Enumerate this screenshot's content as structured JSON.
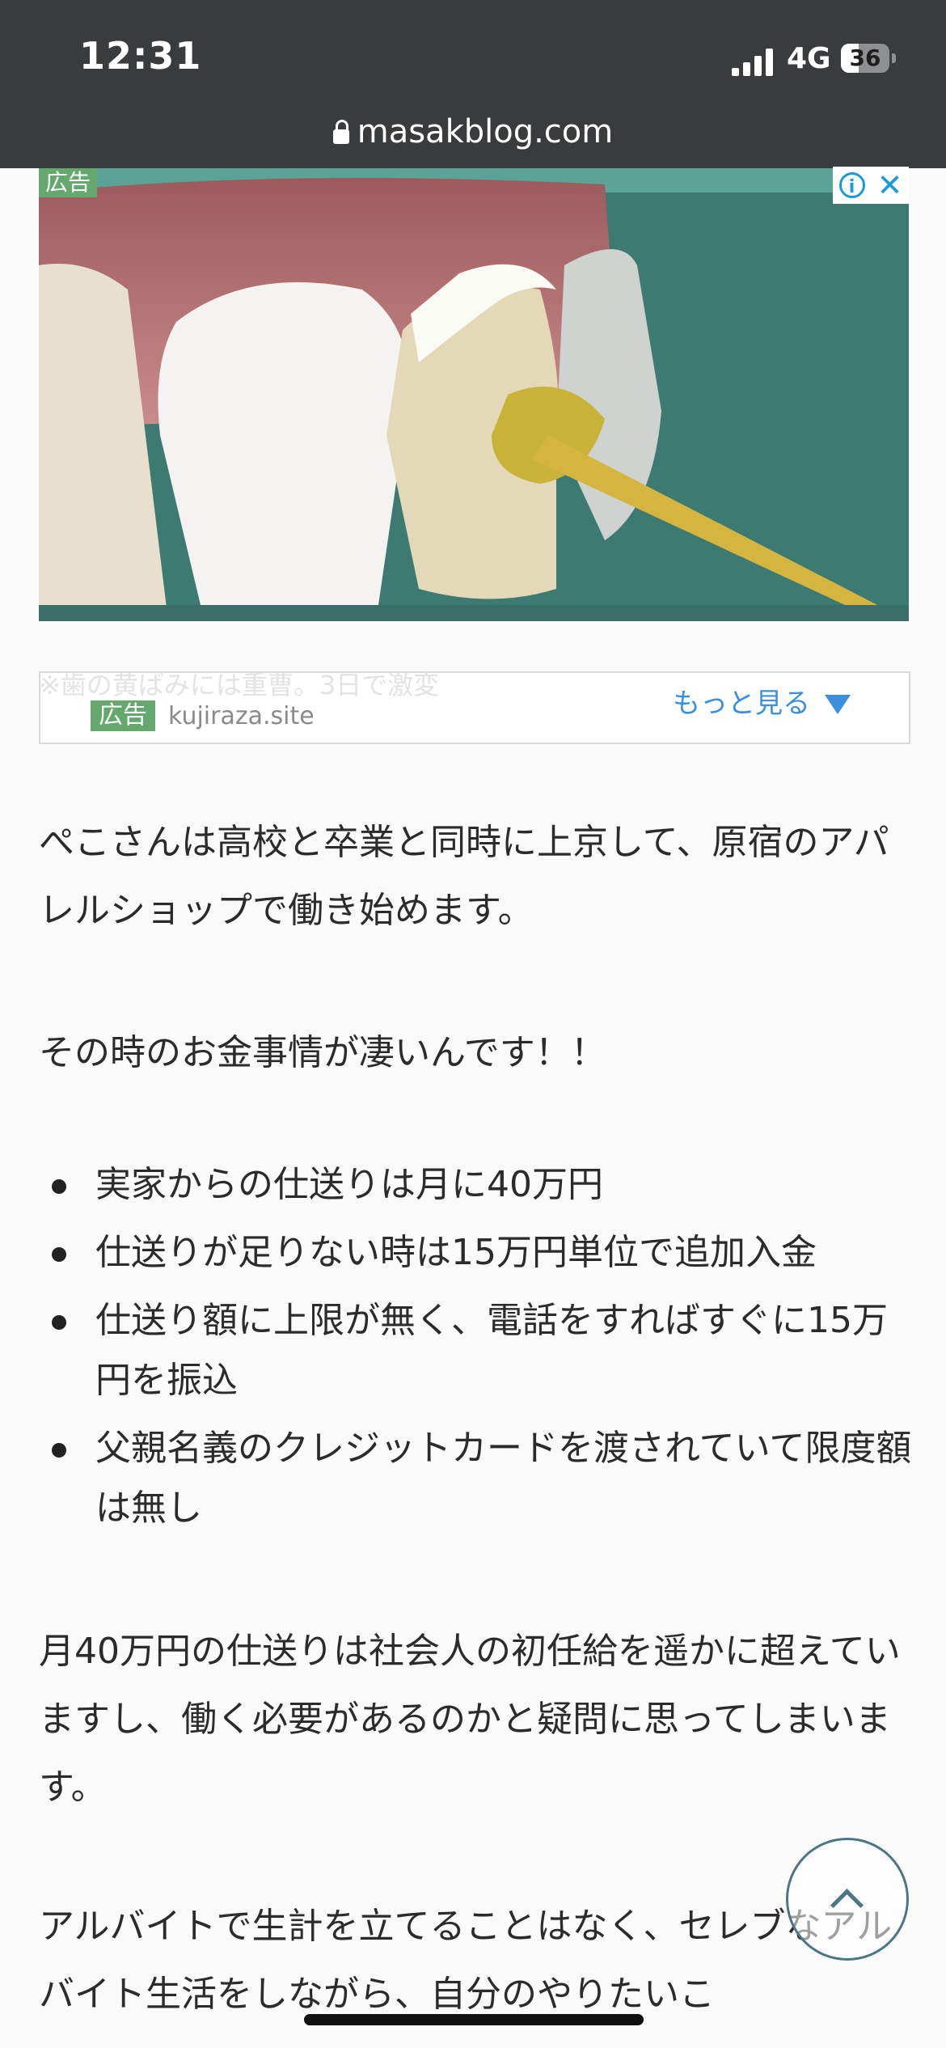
{
  "status_bar": {
    "time": "12:31",
    "network": "4G",
    "battery": "36",
    "icons": [
      "signal-icon",
      "battery-icon"
    ]
  },
  "browser": {
    "url": "masakblog.com",
    "lock_icon": "lock-icon"
  },
  "ad": {
    "top_label": "広告",
    "ghost_text": "※歯の黄ばみには重曹。3日で激変",
    "badge": "広告",
    "domain": "kujiraza.site",
    "more_label": "もっと見る",
    "icons": [
      "info-icon",
      "close-icon",
      "triangle-down-icon"
    ]
  },
  "article": {
    "paragraphs": [
      "ぺこさんは高校と卒業と同時に上京して、原宿のアパレルショップで働き始めます。",
      "その時のお金事情が凄いんです！！"
    ],
    "bullets": [
      "実家からの仕送りは月に40万円",
      "仕送りが足りない時は15万円単位で追加入金",
      "仕送り額に上限が無く、電話をすればすぐに15万円を振込",
      "父親名義のクレジットカードを渡されていて限度額は無し"
    ],
    "paragraphs_after": [
      "月40万円の仕送りは社会人の初任給を遥かに超えていますし、働く必要があるのかと疑問に思ってしまいます。",
      "アルバイトで生計を立てることはなく、セレブなアルバイト生活をしながら、自分のやりたいこ"
    ]
  },
  "colors": {
    "status_bg": "#3a3b3d",
    "ad_green": "#64a86e",
    "link_blue": "#3c8fde",
    "totop_border": "#4b7684"
  }
}
